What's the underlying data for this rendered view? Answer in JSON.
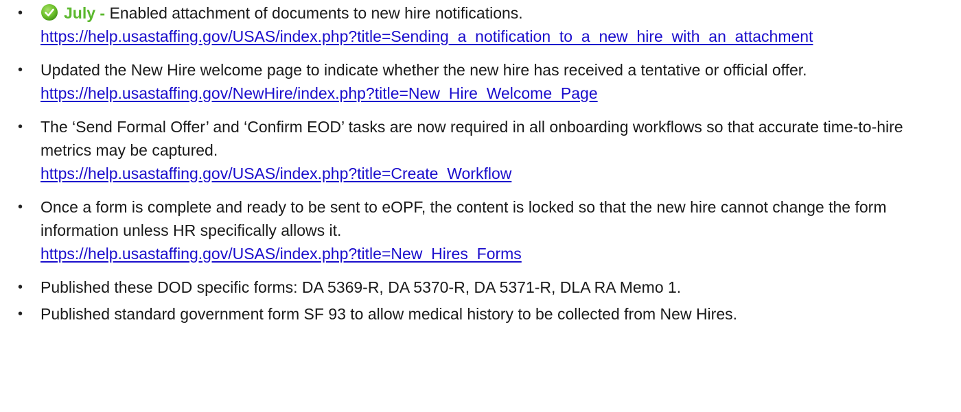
{
  "colors": {
    "month_green": "#5bb82e",
    "link_blue": "#1a0dcc",
    "text": "#1a1a1a"
  },
  "items": [
    {
      "month": "July",
      "separator": " - ",
      "text": "Enabled attachment of documents to new hire notifications.",
      "link": "https://help.usastaffing.gov/USAS/index.php?title=Sending_a_notification_to_a_new_hire_with_an_attachment",
      "icon": "check-circle-icon"
    },
    {
      "text": "Updated the New Hire welcome page to indicate whether the new hire has received a tentative or official offer.",
      "link": "https://help.usastaffing.gov/NewHire/index.php?title=New_Hire_Welcome_Page"
    },
    {
      "text": "The ‘Send Formal Offer’ and ‘Confirm EOD’ tasks are now required in all onboarding workflows so that accurate time-to-hire metrics may be captured.",
      "link": "https://help.usastaffing.gov/USAS/index.php?title=Create_Workflow"
    },
    {
      "text": "Once a form is complete and ready to be sent to eOPF, the content is locked so that the new hire cannot change the form information unless HR specifically allows it.",
      "link": "https://help.usastaffing.gov/USAS/index.php?title=New_Hires_Forms"
    },
    {
      "text": "Published these DOD specific forms: DA 5369-R, DA 5370-R, DA 5371-R, DLA RA Memo 1."
    },
    {
      "text": "Published standard government form SF 93 to allow medical history to be collected from New Hires."
    }
  ],
  "bullet_char": "•"
}
